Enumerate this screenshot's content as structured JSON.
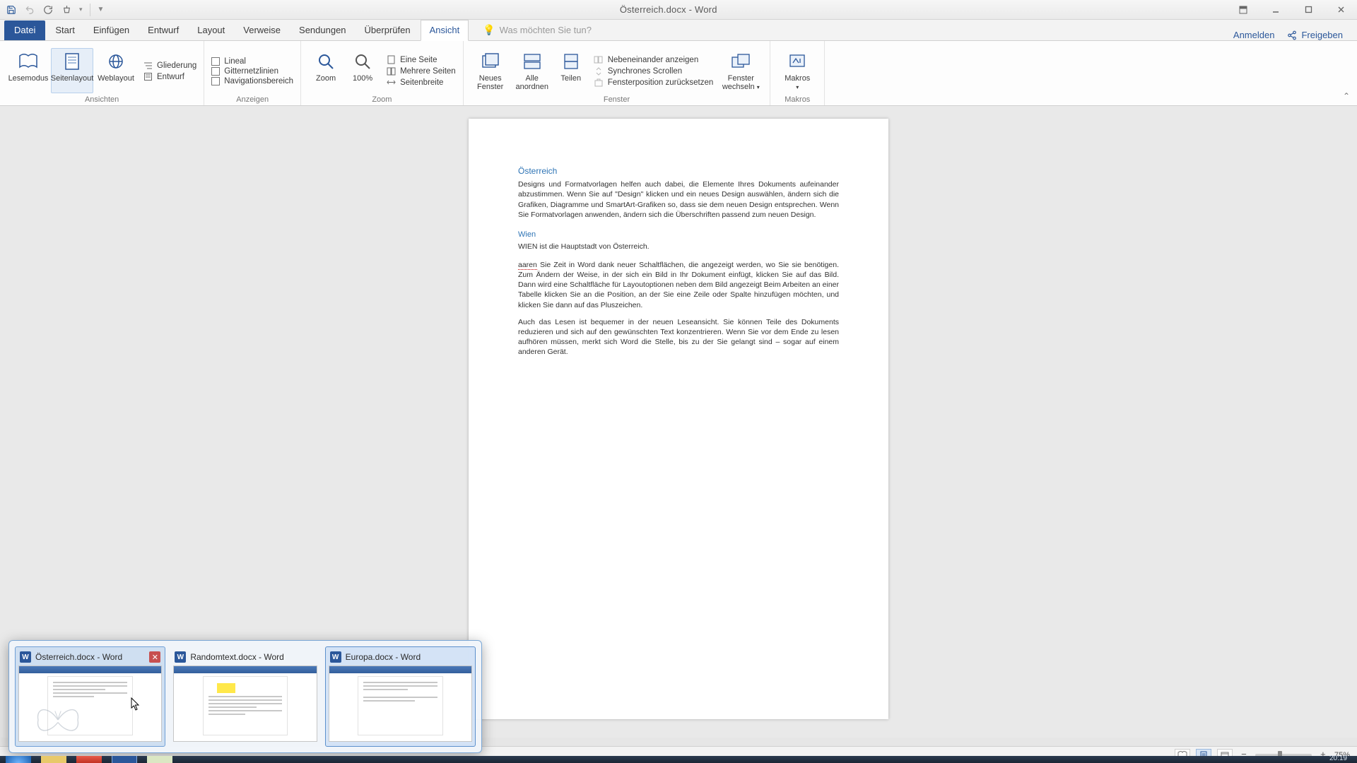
{
  "window": {
    "title": "Österreich.docx - Word",
    "anmelden": "Anmelden",
    "freigeben": "Freigeben"
  },
  "tabs": {
    "file": "Datei",
    "items": [
      "Start",
      "Einfügen",
      "Entwurf",
      "Layout",
      "Verweise",
      "Sendungen",
      "Überprüfen",
      "Ansicht"
    ],
    "active_index": 7,
    "tell_me_placeholder": "Was möchten Sie tun?"
  },
  "ribbon": {
    "groups": {
      "ansichten": {
        "label": "Ansichten",
        "lesemodus": "Lesemodus",
        "seitenlayout": "Seitenlayout",
        "weblayout": "Weblayout",
        "gliederung": "Gliederung",
        "entwurf": "Entwurf"
      },
      "anzeigen": {
        "label": "Anzeigen",
        "lineal": "Lineal",
        "gitternetz": "Gitternetzlinien",
        "navigation": "Navigationsbereich"
      },
      "zoom": {
        "label": "Zoom",
        "zoom": "Zoom",
        "hundred": "100%",
        "eine_seite": "Eine Seite",
        "mehrere": "Mehrere Seiten",
        "seitenbreite": "Seitenbreite"
      },
      "fenster": {
        "label": "Fenster",
        "neues_fenster": "Neues Fenster",
        "alle_anordnen": "Alle anordnen",
        "teilen": "Teilen",
        "nebeneinander": "Nebeneinander anzeigen",
        "synchron": "Synchrones Scrollen",
        "position": "Fensterposition zurücksetzen",
        "wechseln": "Fenster wechseln"
      },
      "makros": {
        "label": "Makros",
        "makros": "Makros"
      }
    }
  },
  "document": {
    "h1": "Österreich",
    "p1": "Designs und Formatvorlagen helfen auch dabei, die Elemente Ihres Dokuments aufeinander abzustimmen. Wenn Sie auf \"Design\" klicken und ein neues Design auswählen, ändern sich die Grafiken, Diagramme und SmartArt-Grafiken so, dass sie dem neuen Design entsprechen. Wenn Sie Formatvorlagen anwenden, ändern sich die Überschriften passend zum neuen Design.",
    "h2": "Wien",
    "p2": "WIEN ist die Hauptstadt von Österreich.",
    "p3_err": "aaren",
    "p3_rest": " Sie Zeit in Word dank neuer Schaltflächen, die angezeigt werden, wo Sie sie benötigen. Zum Ändern der Weise, in der sich ein Bild in Ihr Dokument einfügt, klicken Sie auf das Bild. Dann wird eine Schaltfläche für Layoutoptionen neben dem Bild angezeigt Beim Arbeiten an einer Tabelle klicken Sie an die Position, an der Sie eine Zeile oder Spalte hinzufügen möchten, und klicken Sie dann auf das Pluszeichen.",
    "p4": "Auch das Lesen ist bequemer in der neuen Leseansicht. Sie können Teile des Dokuments reduzieren und sich auf den gewünschten Text konzentrieren. Wenn Sie vor dem Ende zu lesen aufhören müssen, merkt sich Word die Stelle, bis zu der Sie gelangt sind – sogar auf einem anderen Gerät."
  },
  "status": {
    "zoom_pct": "75%"
  },
  "taskbar_previews": [
    {
      "title": "Österreich.docx - Word"
    },
    {
      "title": "Randomtext.docx - Word"
    },
    {
      "title": "Europa.docx - Word"
    }
  ],
  "clock": "20:19"
}
